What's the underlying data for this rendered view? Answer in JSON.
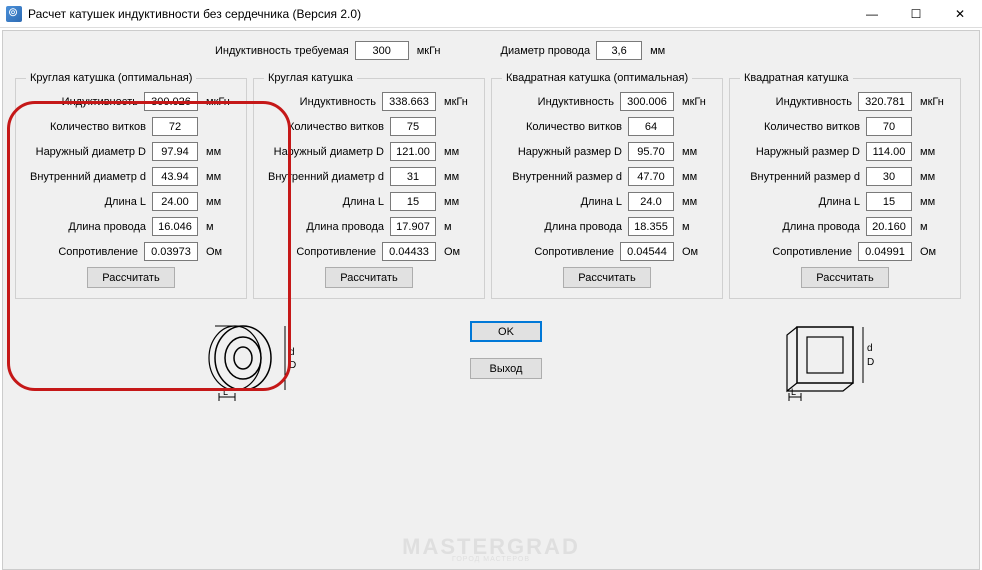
{
  "window": {
    "title": "Расчет катушек индуктивности без сердечника (Версия 2.0)"
  },
  "top": {
    "inductance_label": "Индуктивность требуемая",
    "inductance_value": "300",
    "inductance_unit": "мкГн",
    "wire_diameter_label": "Диаметр провода",
    "wire_diameter_value": "3,6",
    "wire_diameter_unit": "мм"
  },
  "labels": {
    "inductance": "Индуктивность",
    "turns": "Количество витков",
    "outer_d": "Наружный диаметр D",
    "inner_d": "Внутренний диаметр d",
    "outer_sz": "Наружный размер D",
    "inner_sz": "Внутренний размер d",
    "length_l": "Длина L",
    "wire_len": "Длина провода",
    "resistance": "Сопротивление",
    "ukhn": "мкГн",
    "mm": "мм",
    "m": "м",
    "ohm": "Ом",
    "calc": "Рассчитать",
    "ok": "OK",
    "exit": "Выход"
  },
  "groups": [
    {
      "title": "Круглая катушка (оптимальная)",
      "inductance": "300.026",
      "turns": "72",
      "outer": "97.94",
      "inner": "43.94",
      "length": "24.00",
      "wire": "16.046",
      "resistance": "0.03973",
      "is_round": true
    },
    {
      "title": "Круглая катушка",
      "inductance": "338.663",
      "turns": "75",
      "outer": "121.00",
      "inner": "31",
      "length": "15",
      "wire": "17.907",
      "resistance": "0.04433",
      "is_round": true
    },
    {
      "title": "Квадратная катушка (оптимальная)",
      "inductance": "300.006",
      "turns": "64",
      "outer": "95.70",
      "inner": "47.70",
      "length": "24.0",
      "wire": "18.355",
      "resistance": "0.04544",
      "is_round": false
    },
    {
      "title": "Квадратная катушка",
      "inductance": "320.781",
      "turns": "70",
      "outer": "114.00",
      "inner": "30",
      "length": "15",
      "wire": "20.160",
      "resistance": "0.04991",
      "is_round": false
    }
  ],
  "watermark": {
    "main": "MASTERGRAD",
    "sub": "ГОРОД МАСТЕРОВ"
  }
}
